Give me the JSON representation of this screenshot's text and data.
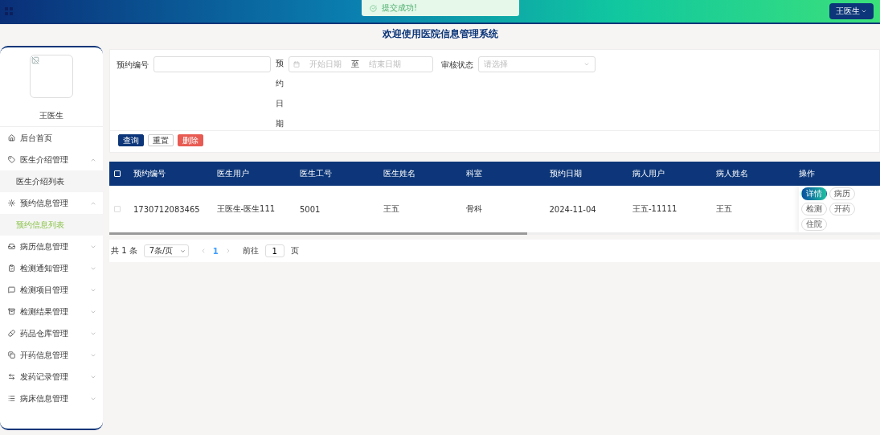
{
  "header": {
    "toast": "提交成功!",
    "user_button": "王医生"
  },
  "title": "欢迎使用医院信息管理系统",
  "sidebar": {
    "user_name": "王医生",
    "items": [
      {
        "kind": "link",
        "label": "后台首页"
      },
      {
        "kind": "group",
        "label": "医生介绍管理",
        "expanded": true,
        "children": [
          {
            "label": "医生介绍列表",
            "selected": false
          }
        ]
      },
      {
        "kind": "group",
        "label": "预约信息管理",
        "expanded": true,
        "children": [
          {
            "label": "预约信息列表",
            "selected": true
          }
        ]
      },
      {
        "kind": "group",
        "label": "病历信息管理",
        "expanded": false
      },
      {
        "kind": "group",
        "label": "检测通知管理",
        "expanded": false
      },
      {
        "kind": "group",
        "label": "检测项目管理",
        "expanded": false
      },
      {
        "kind": "group",
        "label": "检测结果管理",
        "expanded": false
      },
      {
        "kind": "group",
        "label": "药品仓库管理",
        "expanded": false
      },
      {
        "kind": "group",
        "label": "开药信息管理",
        "expanded": false
      },
      {
        "kind": "group",
        "label": "发药记录管理",
        "expanded": false
      },
      {
        "kind": "group",
        "label": "病床信息管理",
        "expanded": false
      }
    ]
  },
  "filters": {
    "number_label": "预约编号",
    "date_label": "预约日期",
    "date_start_placeholder": "开始日期",
    "date_separator": "至",
    "date_end_placeholder": "结束日期",
    "status_label": "审核状态",
    "status_placeholder": "请选择",
    "buttons": [
      {
        "kind": "primary",
        "label": "查询"
      },
      {
        "kind": "plain",
        "label": "重置"
      },
      {
        "kind": "danger",
        "label": "删除"
      }
    ]
  },
  "table": {
    "header_checked": false,
    "columns": [
      "预约编号",
      "医生用户",
      "医生工号",
      "医生姓名",
      "科室",
      "预约日期",
      "病人用户",
      "病人姓名",
      "操作"
    ],
    "rows": [
      {
        "checked": false,
        "cells": [
          "1730712083465",
          "王医生-医生111",
          "5001",
          "王五",
          "骨科",
          "2024-11-04",
          "王五-11111",
          "王五"
        ],
        "actions": [
          {
            "kind": "primary",
            "label": "详情"
          },
          {
            "kind": "plain",
            "label": "病历"
          },
          {
            "kind": "plain",
            "label": "检测"
          },
          {
            "kind": "plain",
            "label": "开药"
          },
          {
            "kind": "plain",
            "label": "住院"
          }
        ]
      }
    ]
  },
  "pagination": {
    "total": "共 1 条",
    "page_size": "7条/页",
    "pages": [
      {
        "label": "1",
        "selected": true
      }
    ],
    "goto_label": "前往",
    "goto_value": "1",
    "goto_suffix": "页"
  }
}
